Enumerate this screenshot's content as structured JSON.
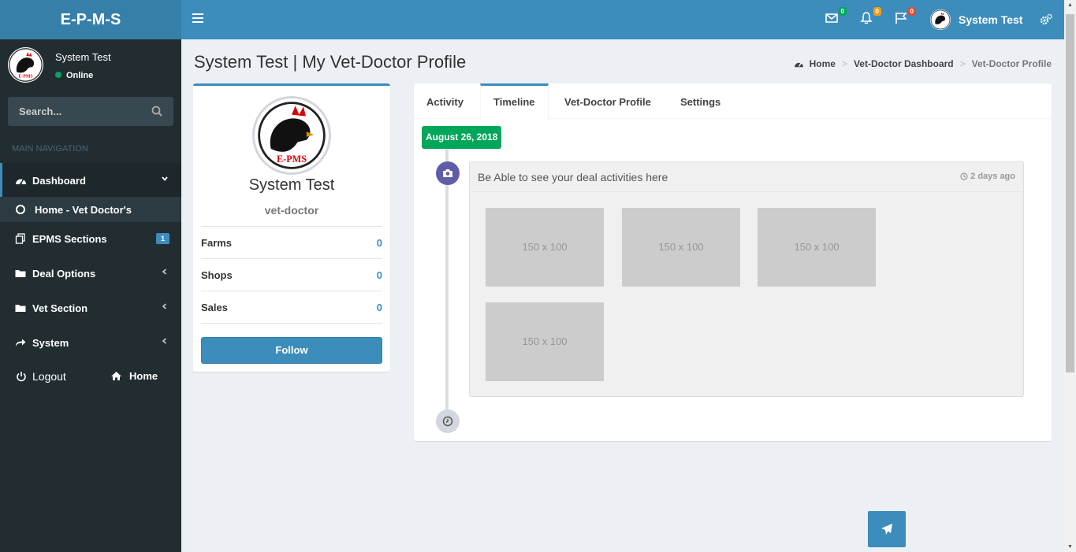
{
  "app": {
    "logo": "E-P-M-S"
  },
  "header": {
    "messages_count": "0",
    "notifications_count": "0",
    "tasks_count": "0",
    "user_name": "System Test",
    "colors": {
      "bar": "#3c8dbc",
      "logo_bg": "#367fa9",
      "messages_badge": "#00a65a",
      "notifications_badge": "#f39c12",
      "tasks_badge": "#dd4b39"
    }
  },
  "sidebar": {
    "user_name": "System Test",
    "status": "Online",
    "search_placeholder": "Search...",
    "nav_header": "MAIN NAVIGATION",
    "items": [
      {
        "label": "Dashboard",
        "icon": "dashboard-icon"
      },
      {
        "label": "Home - Vet Doctor's",
        "icon": "circle-icon"
      },
      {
        "label": "EPMS Sections",
        "icon": "files-icon",
        "badge": "1"
      },
      {
        "label": "Deal Options",
        "icon": "folder-icon"
      },
      {
        "label": "Vet Section",
        "icon": "folder-icon"
      },
      {
        "label": "System",
        "icon": "share-icon"
      }
    ],
    "logout_label": "Logout",
    "home_label": "Home"
  },
  "content": {
    "page_title": "System Test | My Vet-Doctor Profile",
    "breadcrumb": [
      "Home",
      "Vet-Doctor Dashboard",
      "Vet-Doctor Profile"
    ]
  },
  "profile": {
    "name": "System Test",
    "role": "vet-doctor",
    "stats": [
      {
        "label": "Farms",
        "value": "0"
      },
      {
        "label": "Shops",
        "value": "0"
      },
      {
        "label": "Sales",
        "value": "0"
      }
    ],
    "follow_label": "Follow"
  },
  "tabs": [
    "Activity",
    "Timeline",
    "Vet-Doctor Profile",
    "Settings"
  ],
  "active_tab": "Timeline",
  "timeline": {
    "date": "August 26, 2018",
    "item_header": "Be Able to see your deal activities here",
    "item_time": "2 days ago",
    "placeholders": [
      "150 x 100",
      "150 x 100",
      "150 x 100",
      "150 x 100"
    ]
  },
  "logo_text": "E-PMS"
}
